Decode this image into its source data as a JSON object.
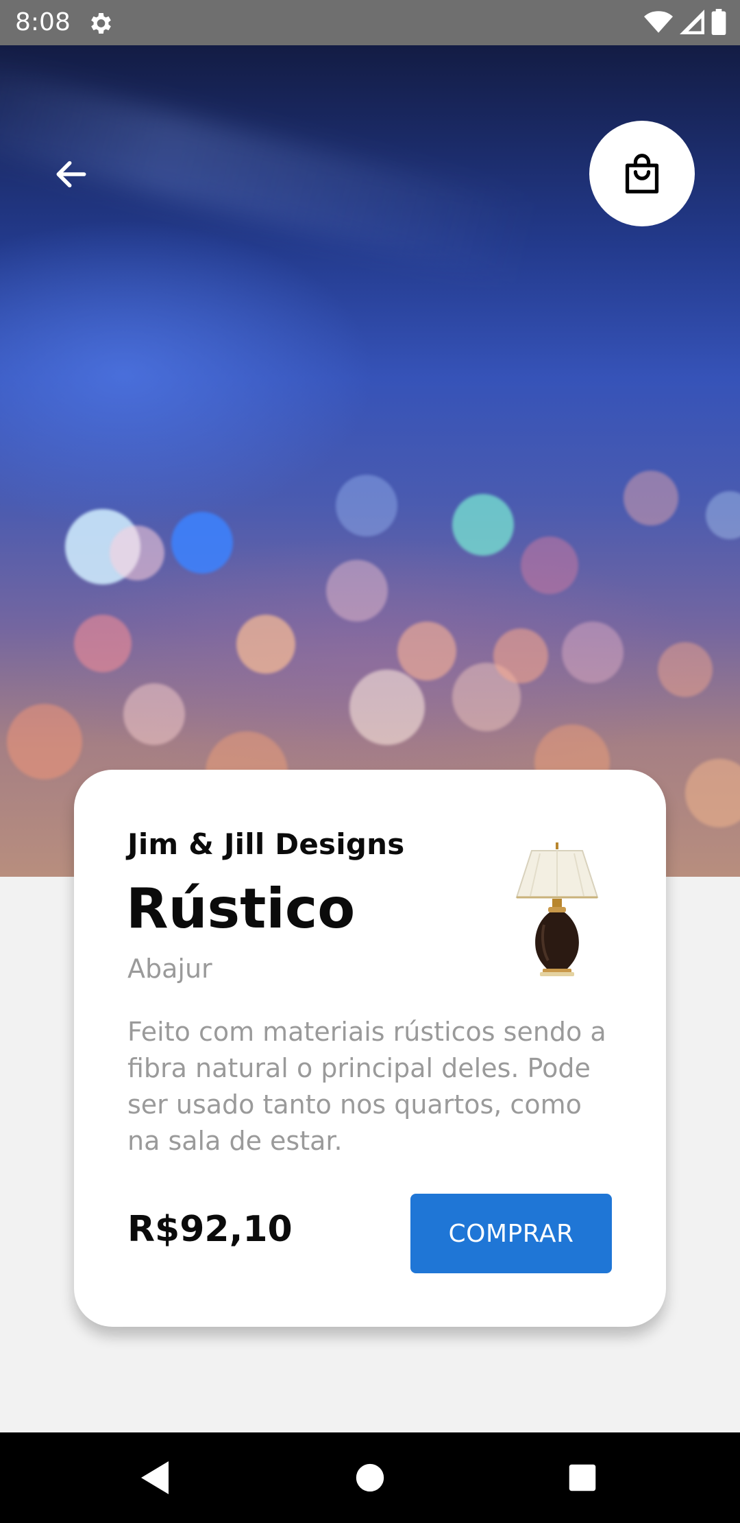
{
  "status_bar": {
    "time": "8:08",
    "icons": [
      "settings-gear-icon",
      "wifi-icon",
      "cellular-signal-icon",
      "battery-icon"
    ]
  },
  "hero": {
    "back_icon": "arrow-left-icon",
    "cart_icon": "shopping-bag-icon"
  },
  "product": {
    "brand": "Jim & Jill Designs",
    "name": "Rústico",
    "category": "Abajur",
    "description": "Feito com materiais rústicos sendo a fibra natural o principal deles. Pode ser usado tanto nos quartos, como na sala de estar.",
    "price": "R$92,10",
    "buy_label": "COMPRAR",
    "image_icon": "table-lamp-image"
  },
  "colors": {
    "accent": "#1f76d6",
    "card_background": "#ffffff",
    "page_background": "#f2f2f2",
    "status_bar": "#6f6f6f"
  },
  "nav_bar": {
    "icons": [
      "back-triangle-icon",
      "home-circle-icon",
      "recents-square-icon"
    ]
  }
}
